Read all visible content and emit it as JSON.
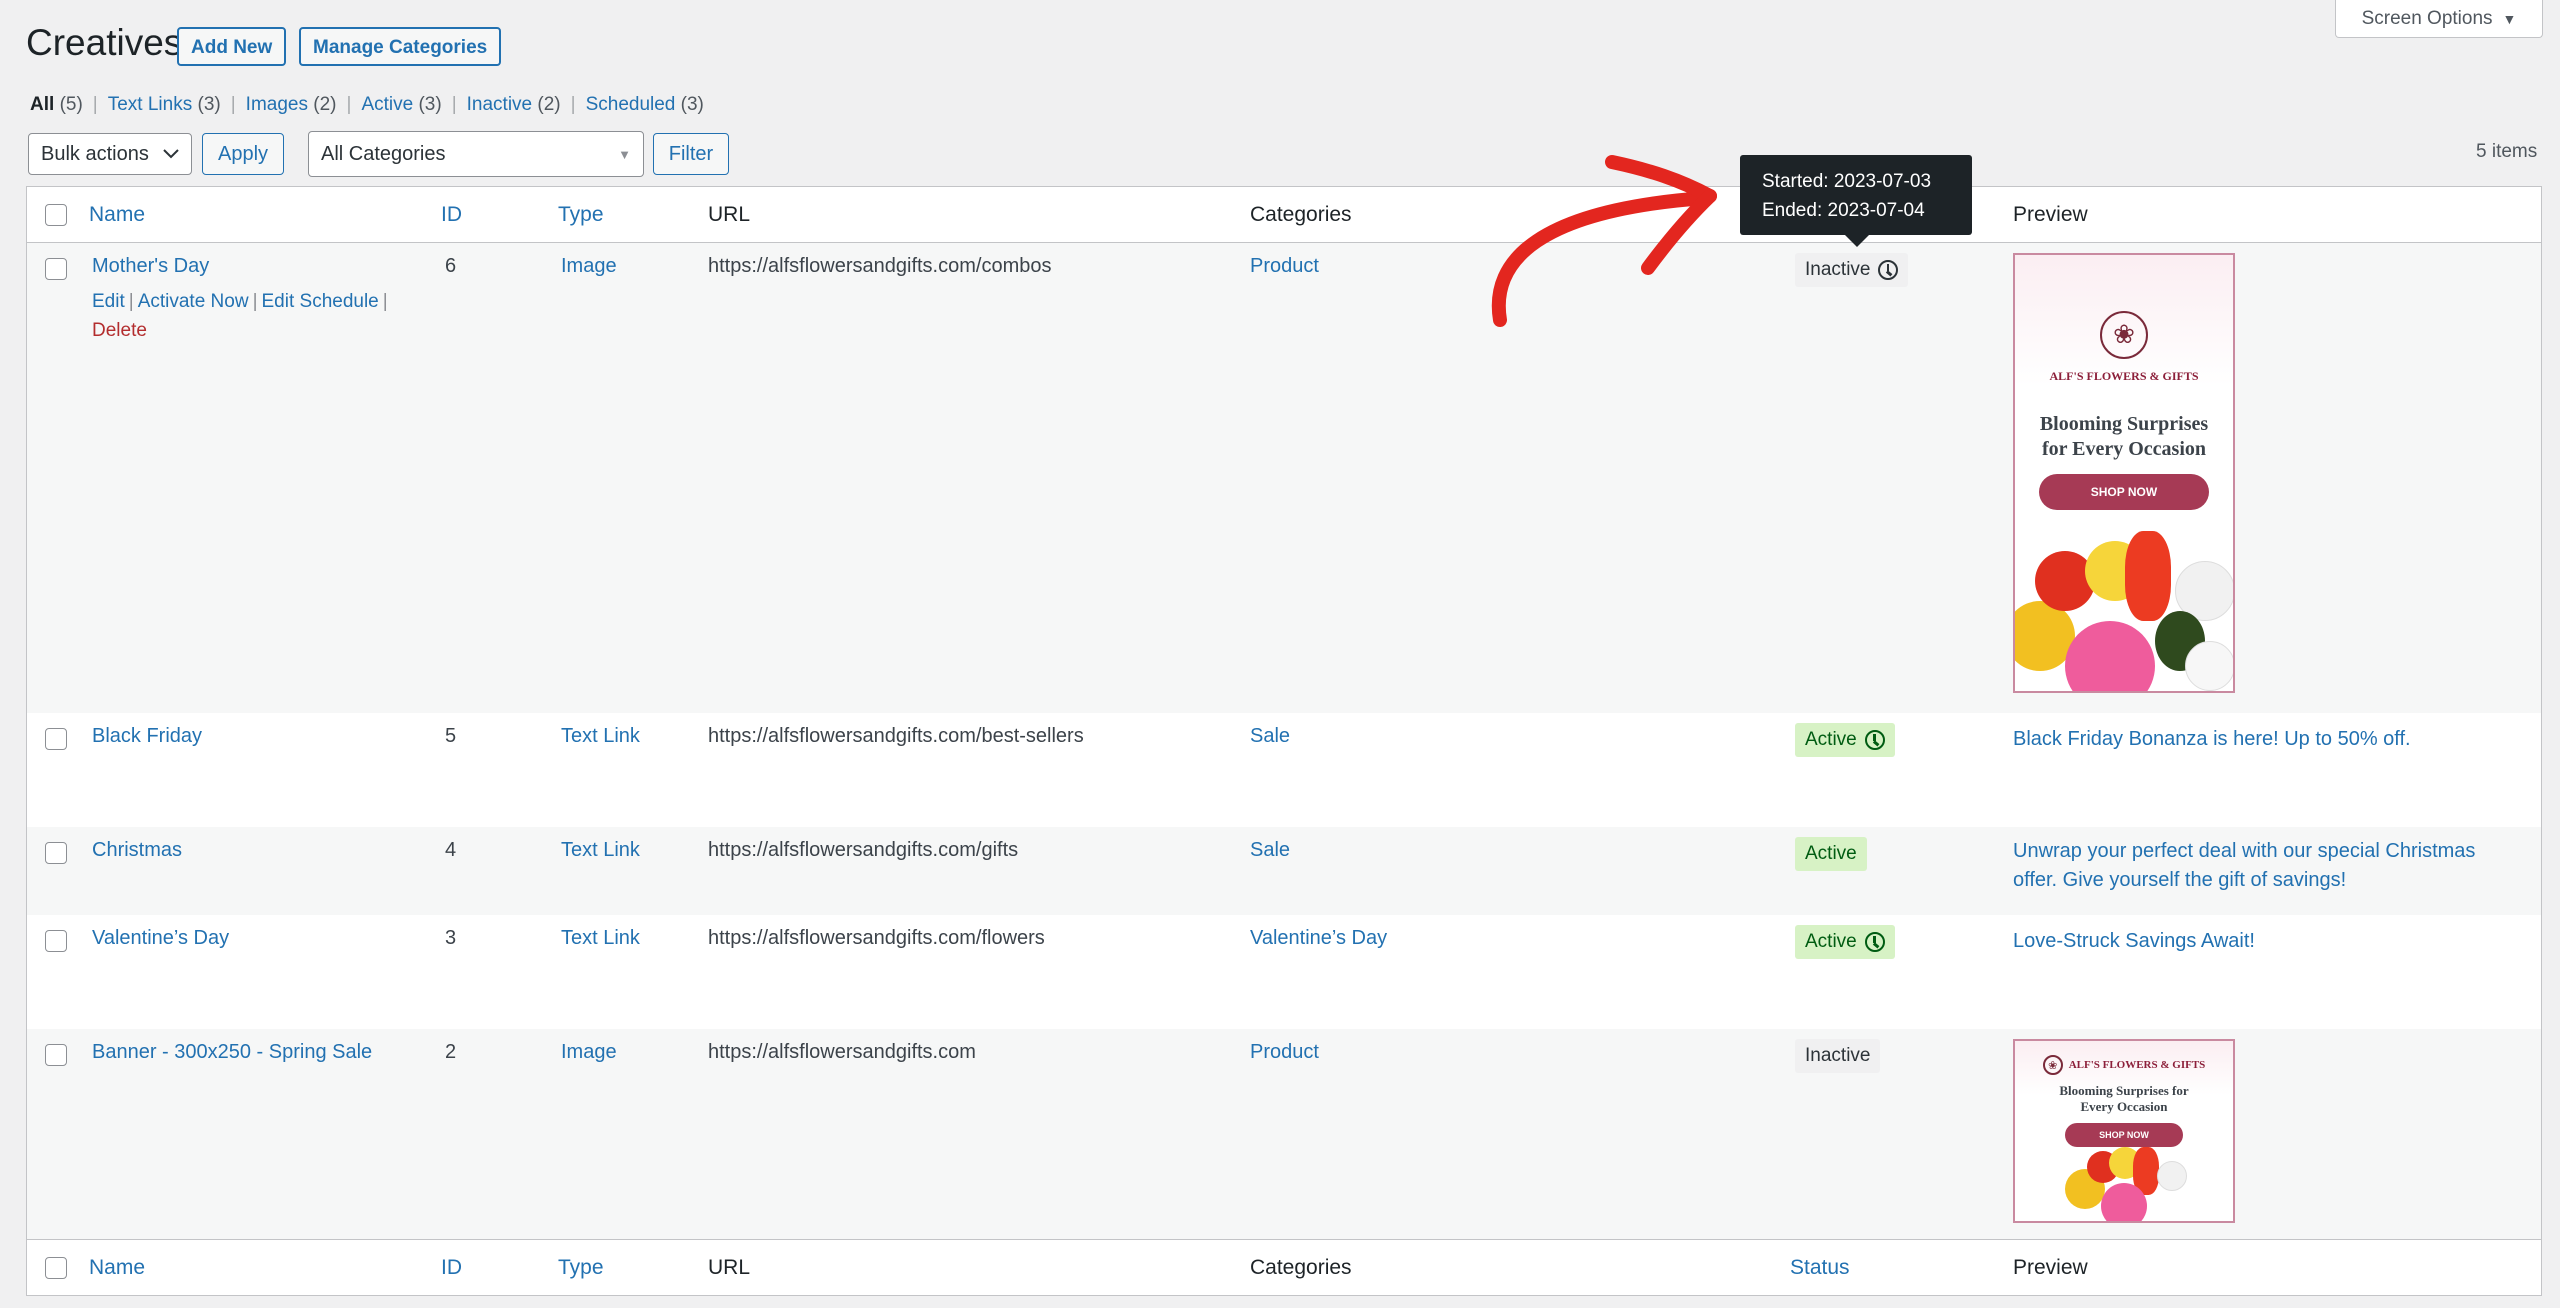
{
  "header": {
    "title": "Creatives",
    "add_new_label": "Add New",
    "manage_categories_label": "Manage Categories",
    "screen_options_label": "Screen Options"
  },
  "views": [
    {
      "label": "All",
      "count": "(5)",
      "current": true
    },
    {
      "label": "Text Links",
      "count": "(3)",
      "current": false
    },
    {
      "label": "Images",
      "count": "(2)",
      "current": false
    },
    {
      "label": "Active",
      "count": "(3)",
      "current": false
    },
    {
      "label": "Inactive",
      "count": "(2)",
      "current": false
    },
    {
      "label": "Scheduled",
      "count": "(3)",
      "current": false
    }
  ],
  "tablenav": {
    "bulk_actions_value": "Bulk actions",
    "apply_label": "Apply",
    "category_filter_value": "All Categories",
    "filter_label": "Filter",
    "items_count": "5 items"
  },
  "columns": {
    "name": "Name",
    "id": "ID",
    "type": "Type",
    "url": "URL",
    "categories": "Categories",
    "status": "Status",
    "preview": "Preview"
  },
  "rows": [
    {
      "name": "Mother's Day",
      "id": "6",
      "type": "Image",
      "url": "https://alfsflowersandgifts.com/combos",
      "category": "Product",
      "status": "Inactive",
      "scheduled": true,
      "row_actions": {
        "edit": "Edit",
        "activate": "Activate Now",
        "edit_schedule": "Edit Schedule",
        "delete": "Delete"
      },
      "preview_type": "image",
      "banner": {
        "brand": "ALF'S FLOWERS & GIFTS",
        "headline": "Blooming Surprises for Every Occasion",
        "cta": "SHOP NOW"
      }
    },
    {
      "name": "Black Friday",
      "id": "5",
      "type": "Text Link",
      "url": "https://alfsflowersandgifts.com/best-sellers",
      "category": "Sale",
      "status": "Active",
      "scheduled": true,
      "preview_type": "text",
      "preview_text": "Black Friday Bonanza is here! Up to 50% off."
    },
    {
      "name": "Christmas",
      "id": "4",
      "type": "Text Link",
      "url": "https://alfsflowersandgifts.com/gifts",
      "category": "Sale",
      "status": "Active",
      "scheduled": false,
      "preview_type": "text",
      "preview_text": "Unwrap your perfect deal with our special Christmas offer. Give yourself the gift of savings!"
    },
    {
      "name": "Valentine’s Day",
      "id": "3",
      "type": "Text Link",
      "url": "https://alfsflowersandgifts.com/flowers",
      "category": "Valentine’s Day",
      "status": "Active",
      "scheduled": true,
      "preview_type": "text",
      "preview_text": "Love-Struck Savings Await!"
    },
    {
      "name": "Banner - 300x250 - Spring Sale",
      "id": "2",
      "type": "Image",
      "url": "https://alfsflowersandgifts.com",
      "category": "Product",
      "status": "Inactive",
      "scheduled": false,
      "preview_type": "image",
      "banner": {
        "brand": "ALF'S FLOWERS & GIFTS",
        "headline": "Blooming Surprises for Every Occasion",
        "cta": "SHOP NOW"
      }
    }
  ],
  "tooltip": {
    "started": "Started: 2023-07-03",
    "ended": "Ended: 2023-07-04"
  },
  "colors": {
    "link": "#2271b1",
    "active_badge_bg": "#d7f2c5",
    "active_badge_text": "#005c12",
    "inactive_badge_bg": "#f0f0f1",
    "delete": "#b32d2e",
    "annotation_arrow": "#e3261f"
  }
}
